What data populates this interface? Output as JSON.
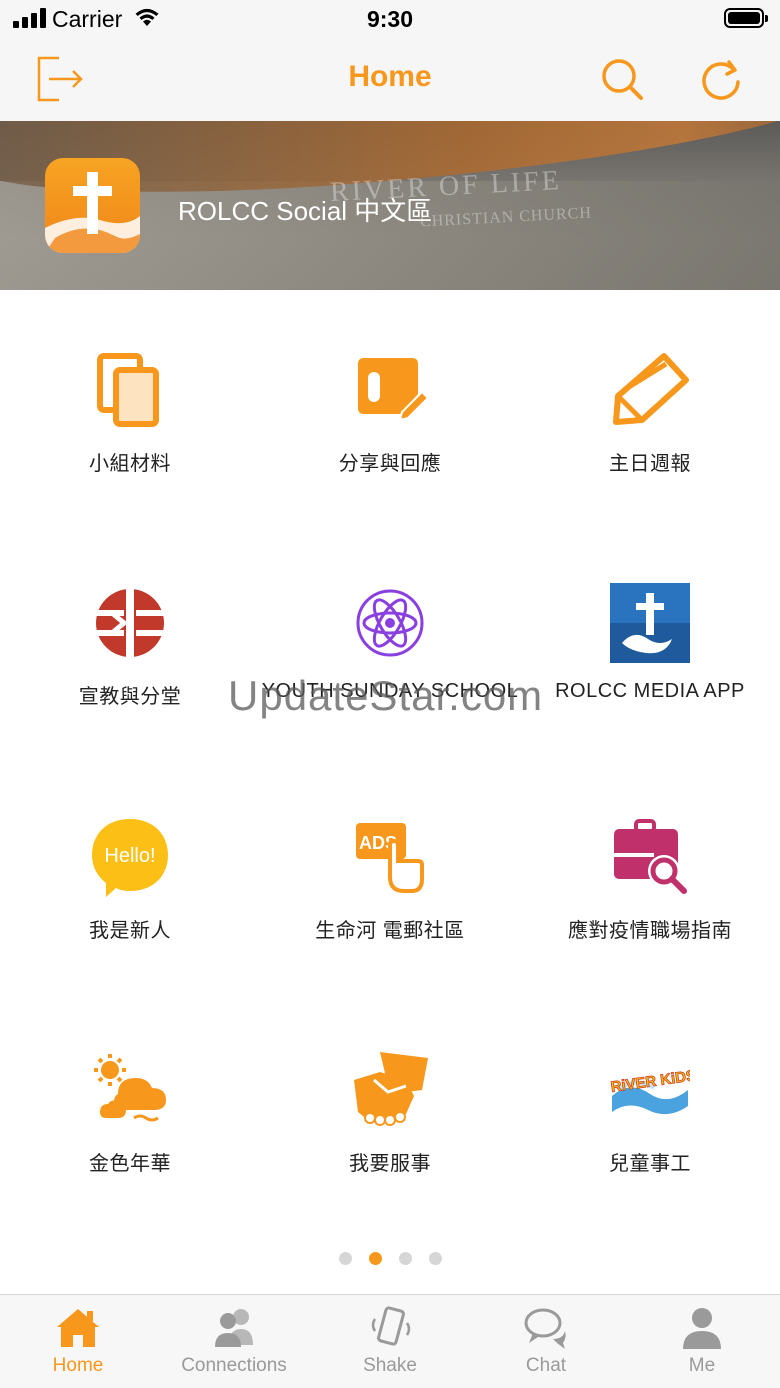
{
  "status_bar": {
    "carrier": "Carrier",
    "time": "9:30"
  },
  "nav": {
    "title": "Home",
    "left_icon": "logout-icon",
    "right_icons": [
      "search-icon",
      "refresh-icon"
    ]
  },
  "banner": {
    "title": "ROLCC Social  中文區",
    "sign_line1": "RIVER OF LIFE",
    "sign_line2": "CHRISTIAN CHURCH"
  },
  "grid": [
    {
      "label": "小組材料",
      "icon": "documents-icon"
    },
    {
      "label": "分享與回應",
      "icon": "note-pencil-icon"
    },
    {
      "label": "主日週報",
      "icon": "pencil-icon"
    },
    {
      "label": "宣教與分堂",
      "icon": "mission-icon"
    },
    {
      "label": "YOUTH SUNDAY SCHOOL",
      "icon": "atom-icon"
    },
    {
      "label": "ROLCC MEDIA APP",
      "icon": "rolcc-media-icon"
    },
    {
      "label": "我是新人",
      "icon": "hello-bubble-icon"
    },
    {
      "label": "生命河 電郵社區",
      "icon": "ads-tap-icon"
    },
    {
      "label": "應對疫情職場指南",
      "icon": "briefcase-search-icon"
    },
    {
      "label": "金色年華",
      "icon": "sun-cloud-icon"
    },
    {
      "label": "我要服事",
      "icon": "handshake-icon"
    },
    {
      "label": "兒童事工",
      "icon": "river-kids-icon"
    }
  ],
  "watermark": "UpdateStar.com",
  "river_kids_text": "RiVER KiDS",
  "hello_text": "Hello!",
  "ads_text": "ADS",
  "pager": {
    "pages": 4,
    "active_page": 2
  },
  "tabs": [
    {
      "label": "Home",
      "icon": "home-icon",
      "active": true
    },
    {
      "label": "Connections",
      "icon": "people-icon",
      "active": false
    },
    {
      "label": "Shake",
      "icon": "shake-phone-icon",
      "active": false
    },
    {
      "label": "Chat",
      "icon": "chat-bubbles-icon",
      "active": false
    },
    {
      "label": "Me",
      "icon": "person-icon",
      "active": false
    }
  ],
  "colors": {
    "accent": "#f7981d",
    "tab_inactive": "#9a9a9a",
    "mission_red": "#c0392b",
    "purple": "#8a3fe0",
    "magenta": "#c0306a",
    "media_blue": "#1f5a9c"
  }
}
